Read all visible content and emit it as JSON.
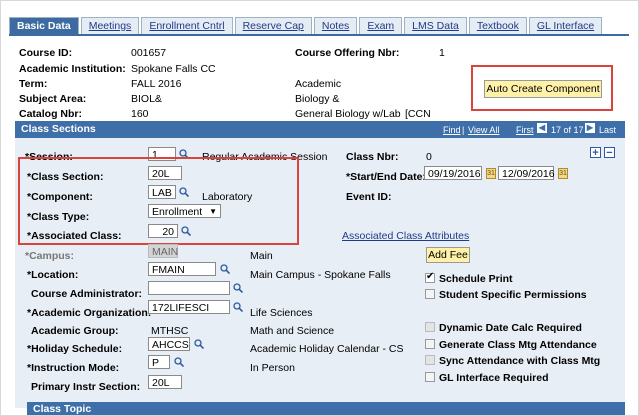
{
  "tabs": [
    {
      "label": "Basic Data",
      "active": true
    },
    {
      "label": "Meetings",
      "active": false
    },
    {
      "label": "Enrollment Cntrl",
      "active": false
    },
    {
      "label": "Reserve Cap",
      "active": false
    },
    {
      "label": "Notes",
      "active": false
    },
    {
      "label": "Exam",
      "active": false
    },
    {
      "label": "LMS Data",
      "active": false
    },
    {
      "label": "Textbook",
      "active": false
    },
    {
      "label": "GL Interface",
      "active": false
    }
  ],
  "header": {
    "course_id_label": "Course ID:",
    "course_id": "001657",
    "institution_label": "Academic Institution:",
    "institution": "Spokane Falls CC",
    "term_label": "Term:",
    "term": "FALL 2016",
    "term_desc": "Academic",
    "subject_label": "Subject Area:",
    "subject": "BIOL&",
    "subject_desc": "Biology &",
    "catalog_label": "Catalog Nbr:",
    "catalog": "160",
    "catalog_desc": "General Biology w/Lab",
    "ccn": "[CCN",
    "offering_label": "Course Offering Nbr:",
    "offering": "1",
    "auto_create": "Auto Create Component"
  },
  "section": {
    "title": "Class Sections",
    "find": "Find",
    "view_all": "View All",
    "first": "First",
    "count": "17 of 17",
    "last": "Last",
    "session_label": "*Session:",
    "session": "1",
    "session_desc": "Regular Academic Session",
    "class_nbr_label": "Class Nbr:",
    "class_nbr": "0",
    "class_section_label": "*Class Section:",
    "class_section": "20L",
    "start_end_label": "*Start/End Date:",
    "start_date": "09/19/2016",
    "end_date": "12/09/2016",
    "component_label": "*Component:",
    "component": "LAB",
    "component_desc": "Laboratory",
    "event_id_label": "Event ID:",
    "class_type_label": "*Class Type:",
    "class_type": "Enrollment",
    "assoc_class_label": "*Associated Class:",
    "assoc_class": "20",
    "assoc_attr_link": "Associated Class Attributes",
    "campus_label": "*Campus:",
    "campus": "MAIN",
    "campus_desc": "Main",
    "add_fee": "Add Fee",
    "location_label": "*Location:",
    "location": "FMAIN",
    "location_desc": "Main Campus - Spokane Falls",
    "schedule_print": "Schedule Print",
    "course_admin_label": "Course Administrator:",
    "course_admin": "",
    "student_perms": "Student Specific Permissions",
    "acad_org_label": "*Academic Organization:",
    "acad_org": "172LIFESCI",
    "acad_org_desc": "Life Sciences",
    "acad_group_label": "Academic Group:",
    "acad_group": "MTHSC",
    "acad_group_desc": "Math and Science",
    "dynamic_date": "Dynamic Date Calc Required",
    "holiday_label": "*Holiday Schedule:",
    "holiday": "AHCCS",
    "holiday_desc": "Academic Holiday Calendar - CS",
    "gen_attendance": "Generate Class Mtg Attendance",
    "sync_attendance": "Sync Attendance with Class Mtg",
    "instr_mode_label": "*Instruction Mode:",
    "instr_mode": "P",
    "instr_mode_desc": "In Person",
    "gl_interface": "GL Interface Required",
    "primary_instr_label": "Primary Instr Section:",
    "primary_instr": "20L",
    "class_topic": "Class Topic"
  },
  "checks": {
    "schedule_print": true,
    "student_perms": false,
    "dynamic_date": false,
    "gen_attendance": false,
    "sync_attendance": false,
    "gl_interface": false
  }
}
